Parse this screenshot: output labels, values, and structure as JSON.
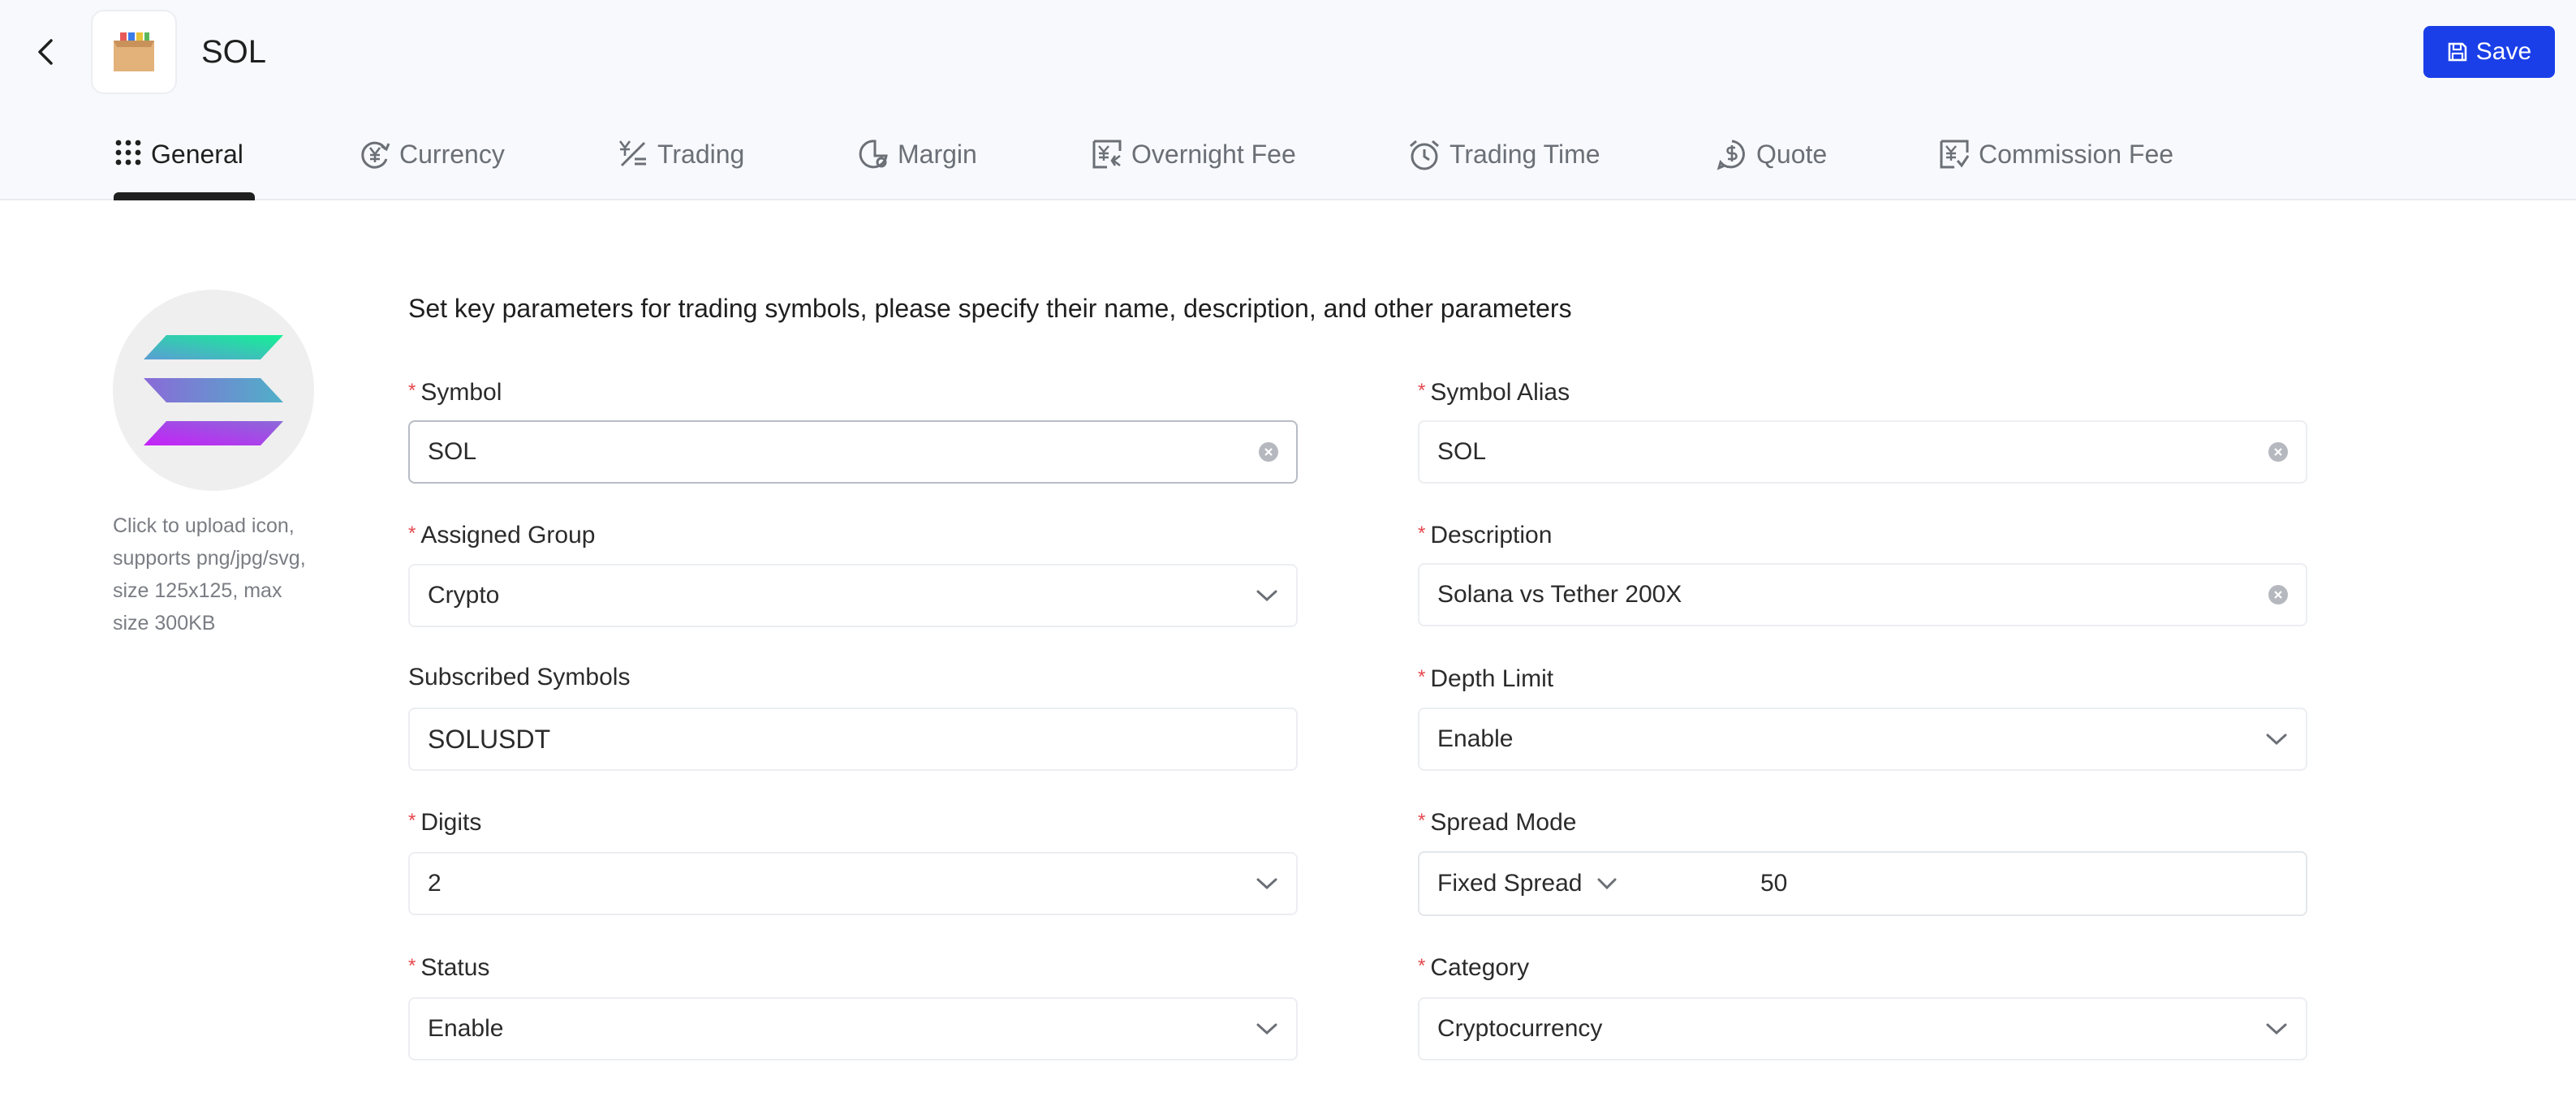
{
  "header": {
    "title": "SOL",
    "save_label": "Save"
  },
  "tabs": [
    {
      "label": "General",
      "icon": "grid-icon",
      "active": true
    },
    {
      "label": "Currency",
      "icon": "currency-icon"
    },
    {
      "label": "Trading",
      "icon": "trading-icon"
    },
    {
      "label": "Margin",
      "icon": "margin-icon"
    },
    {
      "label": "Overnight Fee",
      "icon": "overnight-fee-icon"
    },
    {
      "label": "Trading Time",
      "icon": "alarm-clock-icon"
    },
    {
      "label": "Quote",
      "icon": "quote-icon"
    },
    {
      "label": "Commission Fee",
      "icon": "commission-fee-icon"
    }
  ],
  "upload": {
    "hint_line1": "Click to upload icon,",
    "hint_line2": "supports png/jpg/svg,",
    "hint_line3": "size 125x125, max",
    "hint_line4": "size 300KB"
  },
  "form": {
    "section_title": "Set key parameters for trading symbols, please specify their name, description, and other parameters",
    "symbol": {
      "label": "Symbol",
      "value": "SOL",
      "required": true
    },
    "symbol_alias": {
      "label": "Symbol Alias",
      "value": "SOL",
      "required": true
    },
    "assigned_group": {
      "label": "Assigned Group",
      "value": "Crypto",
      "required": true
    },
    "description": {
      "label": "Description",
      "value": "Solana vs Tether 200X",
      "required": true
    },
    "subscribed_symbols": {
      "label": "Subscribed Symbols",
      "value": "SOLUSDT",
      "required": false
    },
    "depth_limit": {
      "label": "Depth Limit",
      "value": "Enable",
      "required": true
    },
    "digits": {
      "label": "Digits",
      "value": "2",
      "required": true
    },
    "spread_mode": {
      "label": "Spread Mode",
      "mode": "Fixed Spread",
      "value": "50",
      "required": true
    },
    "status": {
      "label": "Status",
      "value": "Enable",
      "required": true
    },
    "category": {
      "label": "Category",
      "value": "Cryptocurrency",
      "required": true
    }
  },
  "colors": {
    "accent": "#1a3fe8",
    "required": "#e5484d",
    "header_bg": "#f7f9fc"
  }
}
